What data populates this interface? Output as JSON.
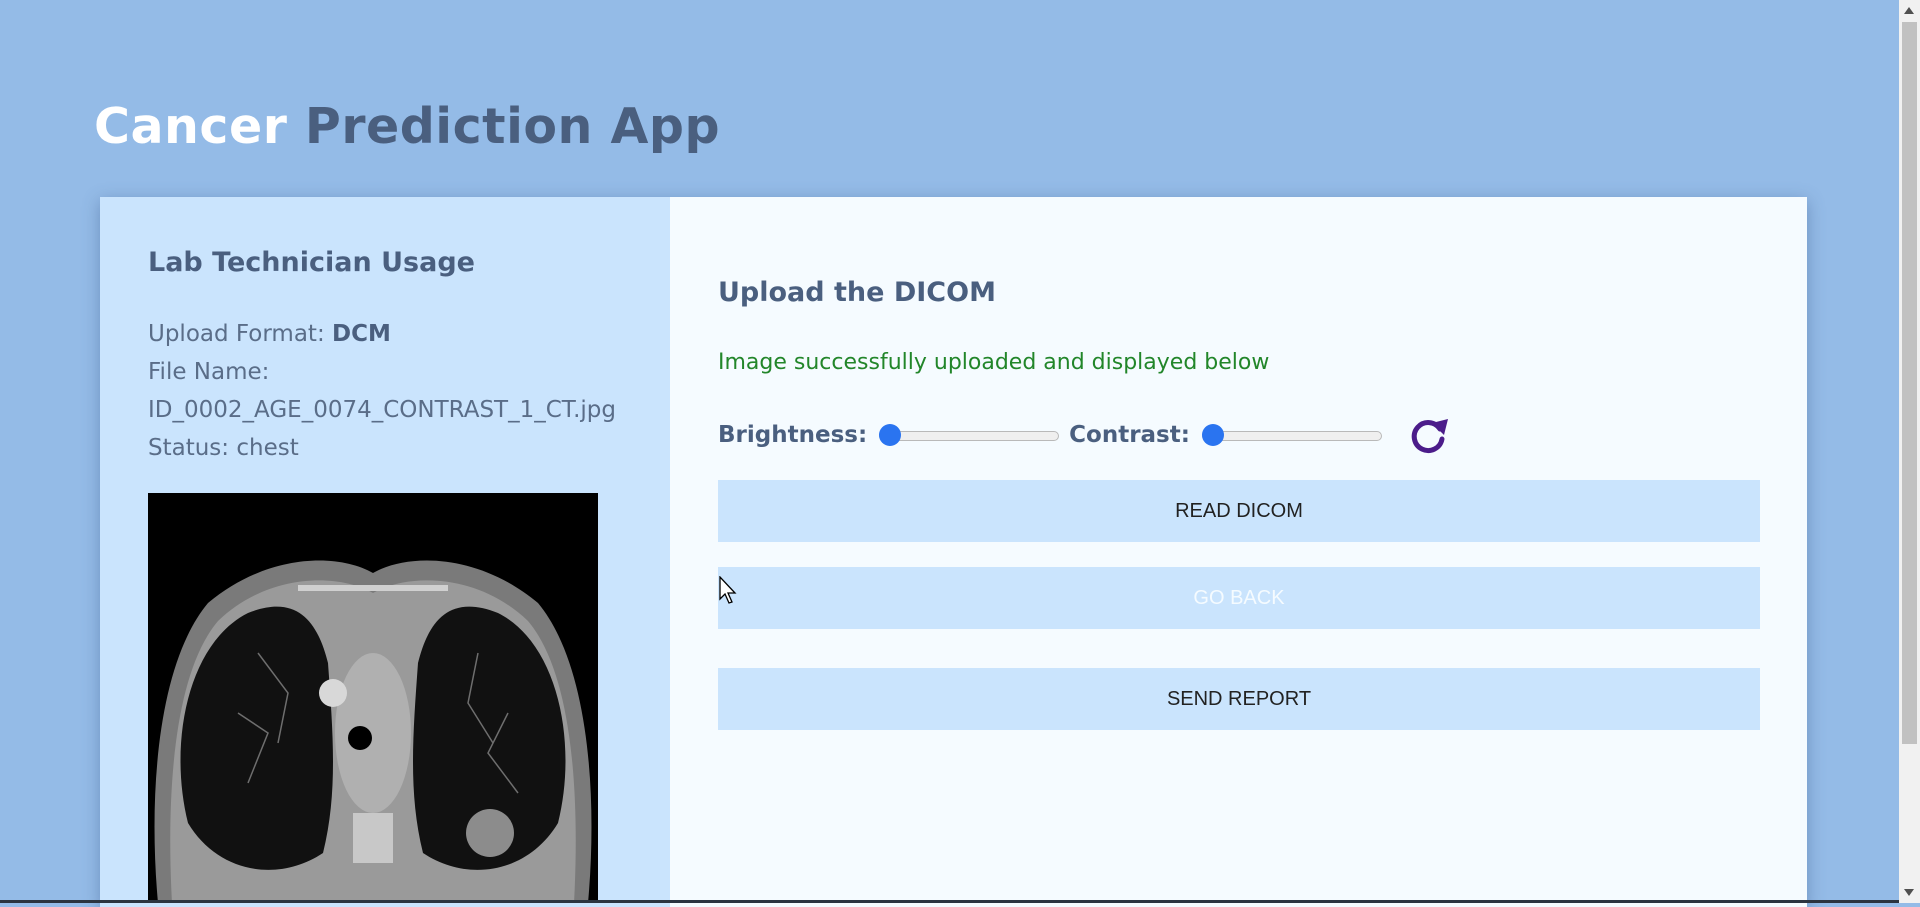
{
  "header": {
    "title_part1": "Cancer",
    "title_part2": "Prediction App"
  },
  "sidebar": {
    "title": "Lab Technician Usage",
    "upload_format_label": "Upload Format:",
    "upload_format_value": "DCM",
    "file_name_label": "File Name:",
    "file_name_value": "ID_0002_AGE_0074_CONTRAST_1_CT.jpg",
    "status_label": "Status:",
    "status_value": "chest",
    "image_alt": "chest CT scan"
  },
  "main": {
    "title": "Upload the DICOM",
    "success_message": "Image successfully uploaded and displayed below",
    "brightness_label": "Brightness:",
    "contrast_label": "Contrast:",
    "brightness_value": 0,
    "contrast_value": 0,
    "reset_icon": "rotate-cw-icon",
    "buttons": {
      "read_dicom": "READ DICOM",
      "go_back": "GO BACK",
      "send_report": "SEND REPORT"
    }
  },
  "colors": {
    "background": "#94bbe7",
    "sidebar": "#cae4fd",
    "main_panel": "#f5fbff",
    "accent_title_dark": "#4a5f7f",
    "success": "#22862a",
    "slider_thumb": "#2a74f0",
    "reset_icon": "#4b1c8a"
  }
}
